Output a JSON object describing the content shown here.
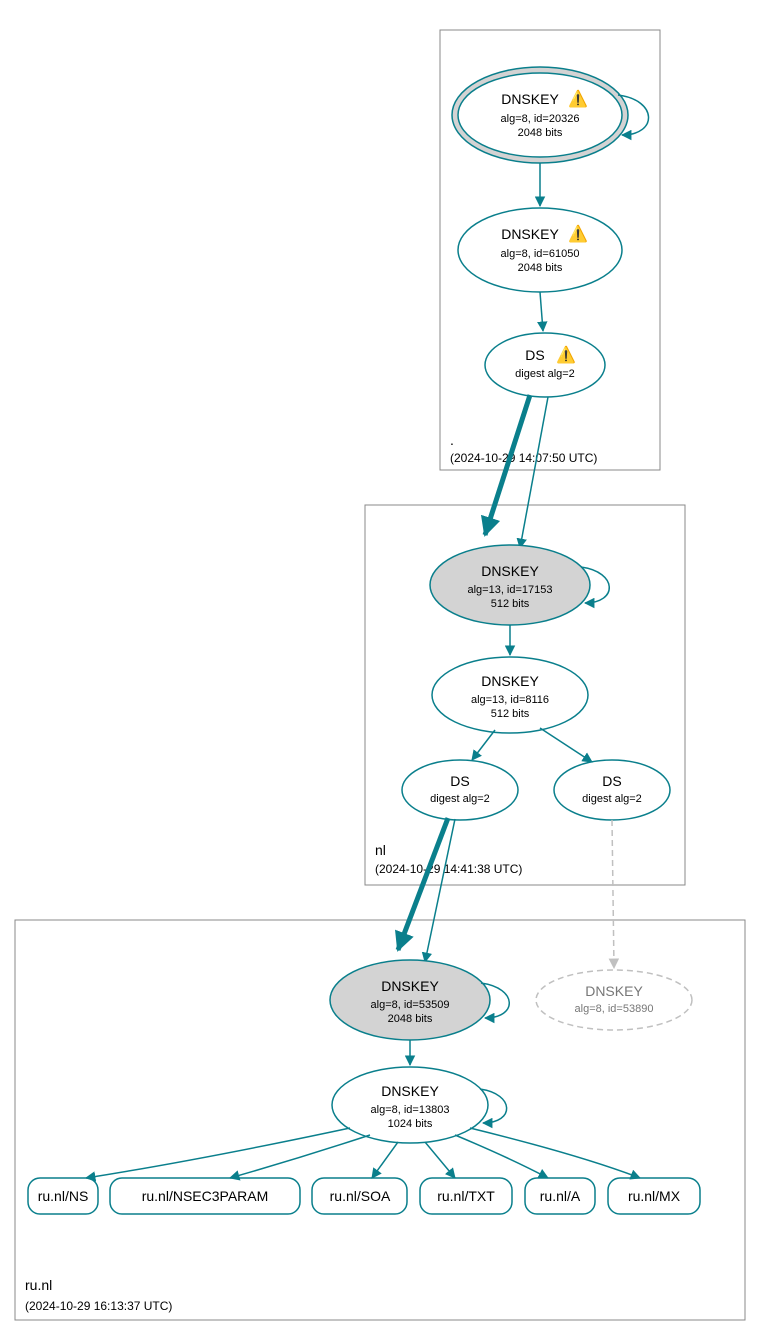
{
  "colors": {
    "stroke": "#0a7f8c",
    "ksk_fill": "#d3d3d3",
    "faded": "#c0c0c0"
  },
  "zones": {
    "root": {
      "label": ".",
      "timestamp": "(2024-10-29 14:07:50 UTC)"
    },
    "nl": {
      "label": "nl",
      "timestamp": "(2024-10-29 14:41:38 UTC)"
    },
    "runl": {
      "label": "ru.nl",
      "timestamp": "(2024-10-29 16:13:37 UTC)"
    }
  },
  "nodes": {
    "root_ksk": {
      "title": "DNSKEY",
      "line1": "alg=8, id=20326",
      "line2": "2048 bits",
      "warn": "⚠️"
    },
    "root_zsk": {
      "title": "DNSKEY",
      "line1": "alg=8, id=61050",
      "line2": "2048 bits",
      "warn": "⚠️"
    },
    "root_ds": {
      "title": "DS",
      "line1": "digest alg=2",
      "warn": "⚠️"
    },
    "nl_ksk": {
      "title": "DNSKEY",
      "line1": "alg=13, id=17153",
      "line2": "512 bits"
    },
    "nl_zsk": {
      "title": "DNSKEY",
      "line1": "alg=13, id=8116",
      "line2": "512 bits"
    },
    "nl_ds1": {
      "title": "DS",
      "line1": "digest alg=2"
    },
    "nl_ds2": {
      "title": "DS",
      "line1": "digest alg=2"
    },
    "ru_ksk": {
      "title": "DNSKEY",
      "line1": "alg=8, id=53509",
      "line2": "2048 bits"
    },
    "ru_ghost": {
      "title": "DNSKEY",
      "line1": "alg=8, id=53890"
    },
    "ru_zsk": {
      "title": "DNSKEY",
      "line1": "alg=8, id=13803",
      "line2": "1024 bits"
    }
  },
  "rrsets": {
    "ns": "ru.nl/NS",
    "nsec3": "ru.nl/NSEC3PARAM",
    "soa": "ru.nl/SOA",
    "txt": "ru.nl/TXT",
    "a": "ru.nl/A",
    "mx": "ru.nl/MX"
  }
}
